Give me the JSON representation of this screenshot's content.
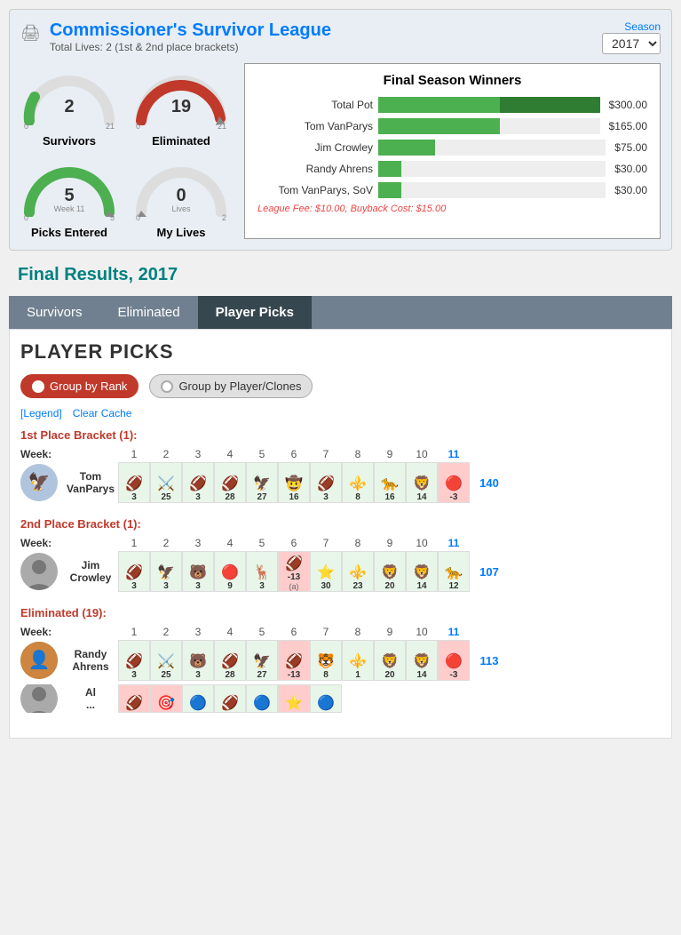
{
  "dashboard": {
    "title": "Commissioner's Survivor League",
    "subtitle": "Total Lives: 2 (1st & 2nd place brackets)",
    "season_label": "Season",
    "season_value": "2017",
    "gauges": [
      {
        "id": "survivors",
        "value": 2,
        "min": 0,
        "max": 21,
        "label": "Survivors",
        "color": "#4caf50",
        "fill_pct": 9
      },
      {
        "id": "eliminated",
        "value": 19,
        "min": 0,
        "max": 21,
        "label": "Eliminated",
        "color": "#c0392b",
        "fill_pct": 90
      },
      {
        "id": "picks",
        "value": 5,
        "min": 0,
        "max": 5,
        "label": "Picks Entered",
        "color": "#4caf50",
        "sub_label": "Week 11",
        "fill_pct": 100
      },
      {
        "id": "lives",
        "value": 0,
        "min": 0,
        "max": 2,
        "label": "My Lives",
        "color": "#ccc",
        "fill_pct": 0
      }
    ],
    "chart": {
      "title": "Final Season Winners",
      "rows": [
        {
          "label": "Total Pot",
          "value": "$300.00",
          "pct": 100,
          "color": "#2e7d32",
          "pct2": 55,
          "color2": "#4caf50"
        },
        {
          "label": "Tom VanParys",
          "value": "$165.00",
          "pct": 55,
          "color": "#4caf50"
        },
        {
          "label": "Jim Crowley",
          "value": "$75.00",
          "pct": 25,
          "color": "#4caf50"
        },
        {
          "label": "Randy Ahrens",
          "value": "$30.00",
          "pct": 10,
          "color": "#4caf50"
        },
        {
          "label": "Tom VanParys, SoV",
          "value": "$30.00",
          "pct": 10,
          "color": "#4caf50"
        }
      ],
      "footer": "League Fee: $10.00, Buyback Cost: $15.00"
    }
  },
  "final_results": {
    "title": "Final Results, 2017"
  },
  "tabs": [
    {
      "id": "survivors",
      "label": "Survivors"
    },
    {
      "id": "eliminated",
      "label": "Eliminated"
    },
    {
      "id": "player-picks",
      "label": "Player Picks",
      "active": true
    }
  ],
  "player_picks": {
    "title": "PLAYER PICKS",
    "toggle_group_rank": "Group by Rank",
    "toggle_group_player": "Group by Player/Clones",
    "legend_label": "[Legend]",
    "clear_cache_label": "Clear Cache",
    "brackets": [
      {
        "id": "bracket-1st",
        "title": "1st Place Bracket (1):",
        "weeks": [
          1,
          2,
          3,
          4,
          5,
          6,
          7,
          8,
          9,
          10,
          11
        ],
        "highlight_week": 11,
        "players": [
          {
            "name": "Tom\nVanParys",
            "avatar_type": "team",
            "avatar_team": "🦅",
            "total": 140,
            "picks": [
              {
                "team": "🏈",
                "score": 3,
                "neg": false,
                "color": "#e8f5e9"
              },
              {
                "team": "⚔️",
                "score": 25,
                "neg": false,
                "color": "#e8f5e9"
              },
              {
                "team": "🏈",
                "score": 3,
                "neg": false,
                "color": "#e8f5e9"
              },
              {
                "team": "🏈",
                "score": 28,
                "neg": false,
                "color": "#e8f5e9"
              },
              {
                "team": "🦅",
                "score": 27,
                "neg": false,
                "color": "#e8f5e9"
              },
              {
                "team": "🤠",
                "score": 16,
                "neg": false,
                "color": "#e8f5e9"
              },
              {
                "team": "🏈",
                "score": 3,
                "neg": false,
                "color": "#e8f5e9"
              },
              {
                "team": "⚜️",
                "score": 8,
                "neg": false,
                "color": "#e8f5e9"
              },
              {
                "team": "🐆",
                "score": 16,
                "neg": false,
                "color": "#e8f5e9"
              },
              {
                "team": "🦁",
                "score": 14,
                "neg": false,
                "color": "#e8f5e9"
              },
              {
                "team": "🔴",
                "score": -3,
                "neg": true,
                "color": "#ffcccc"
              }
            ]
          }
        ]
      },
      {
        "id": "bracket-2nd",
        "title": "2nd Place Bracket (1):",
        "weeks": [
          1,
          2,
          3,
          4,
          5,
          6,
          7,
          8,
          9,
          10,
          11
        ],
        "highlight_week": 11,
        "players": [
          {
            "name": "Jim\nCrowley",
            "avatar_type": "silhouette",
            "total": 107,
            "picks": [
              {
                "team": "🏈",
                "score": 3,
                "neg": false
              },
              {
                "team": "🦅",
                "score": 3,
                "neg": false
              },
              {
                "team": "🐻",
                "score": 3,
                "neg": false
              },
              {
                "team": "🔴",
                "score": 9,
                "neg": false
              },
              {
                "team": "🦌",
                "score": 3,
                "neg": false
              },
              {
                "team": "🏈",
                "score": -13,
                "neg": true,
                "label": "(a)"
              },
              {
                "team": "⭐",
                "score": 30,
                "neg": false
              },
              {
                "team": "⚜️",
                "score": 23,
                "neg": false
              },
              {
                "team": "🦁",
                "score": 20,
                "neg": false
              },
              {
                "team": "🦁",
                "score": 14,
                "neg": false
              },
              {
                "team": "🐆",
                "score": 12,
                "neg": false
              }
            ]
          }
        ]
      },
      {
        "id": "bracket-eliminated",
        "title": "Eliminated (19):",
        "weeks": [
          1,
          2,
          3,
          4,
          5,
          6,
          7,
          8,
          9,
          10,
          11
        ],
        "highlight_week": 11,
        "players": [
          {
            "name": "Randy\nAhrens",
            "avatar_type": "image",
            "total": 113,
            "picks": [
              {
                "team": "🏈",
                "score": 3,
                "neg": false
              },
              {
                "team": "⚔️",
                "score": 25,
                "neg": false
              },
              {
                "team": "🐻",
                "score": 3,
                "neg": false
              },
              {
                "team": "🏈",
                "score": 28,
                "neg": false
              },
              {
                "team": "🦅",
                "score": 27,
                "neg": false
              },
              {
                "team": "🏈",
                "score": -13,
                "neg": true
              },
              {
                "team": "🐯",
                "score": 8,
                "neg": false
              },
              {
                "team": "⚜️",
                "score": 1,
                "neg": false
              },
              {
                "team": "🦁",
                "score": 20,
                "neg": false
              },
              {
                "team": "🦁",
                "score": 14,
                "neg": false
              },
              {
                "team": "🔴",
                "score": -3,
                "neg": true
              }
            ]
          },
          {
            "name": "Al\n...",
            "avatar_type": "silhouette",
            "total": null,
            "picks": []
          }
        ]
      }
    ]
  }
}
